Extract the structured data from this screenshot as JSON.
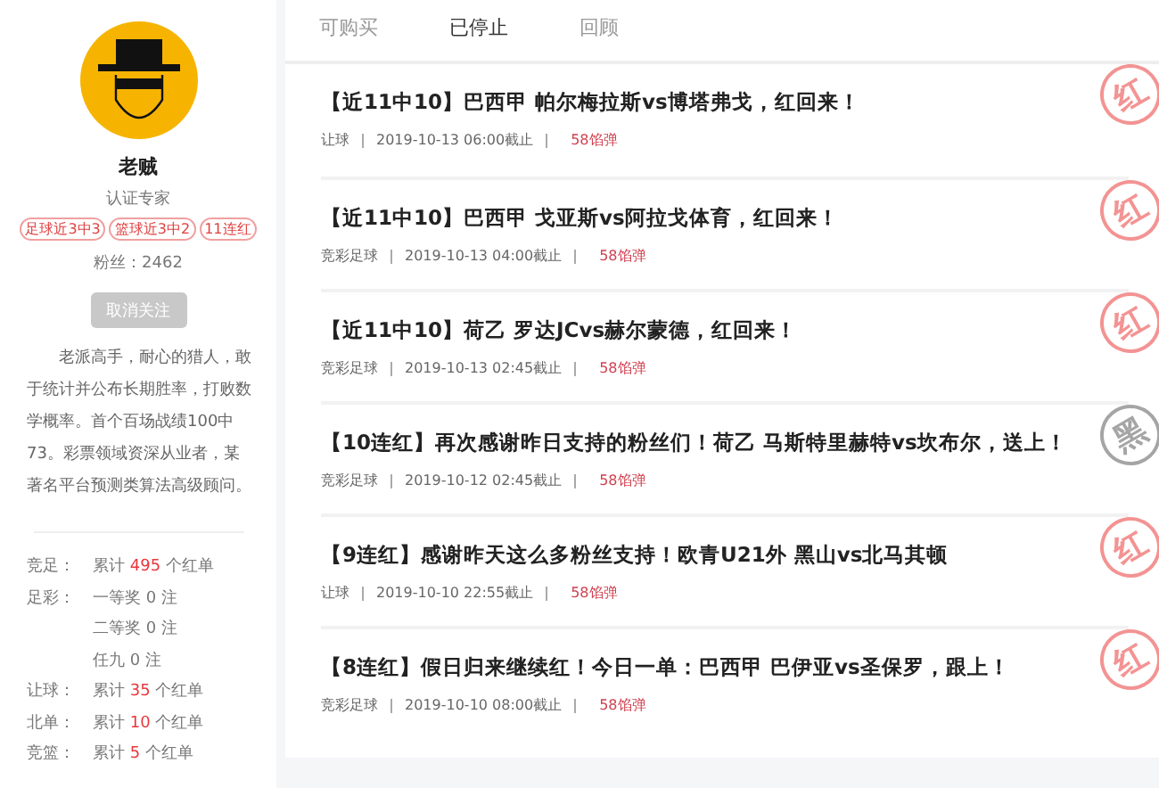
{
  "profile": {
    "name": "老贼",
    "role": "认证专家",
    "badges": [
      "足球近3中3",
      "篮球近3中2",
      "11连红"
    ],
    "fans_label": "粉丝：",
    "fans": "2462",
    "follow_button": "取消关注",
    "bio": "老派高手，耐心的猎人，敢于统计并公布长期胜率，打败数学概率。首个百场战绩100中73。彩票领域资深从业者，某著名平台预测类算法高级顾问。"
  },
  "stats": [
    {
      "label": "竞足：",
      "prefix": "累计",
      "count": "495",
      "suffix": "个红单",
      "highlight": true
    },
    {
      "label": "足彩：",
      "prefix": "一等奖",
      "count": "0",
      "suffix": "注",
      "highlight": false
    },
    {
      "prefix": "二等奖",
      "count": "0",
      "suffix": "注",
      "highlight": false
    },
    {
      "prefix": "任九",
      "count": "0",
      "suffix": "注",
      "highlight": false
    },
    {
      "label": "让球：",
      "prefix": "累计",
      "count": "35",
      "suffix": "个红单",
      "highlight": true
    },
    {
      "label": "北单：",
      "prefix": "累计",
      "count": "10",
      "suffix": "个红单",
      "highlight": true
    },
    {
      "label": "竞篮：",
      "prefix": "累计",
      "count": "5",
      "suffix": "个红单",
      "highlight": true
    }
  ],
  "tabs": [
    {
      "label": "可购买",
      "selected": false
    },
    {
      "label": "已停止",
      "selected": true
    },
    {
      "label": "回顾",
      "selected": false
    }
  ],
  "posts": [
    {
      "title": "【近11中10】巴西甲 帕尔梅拉斯vs博塔弗戈，红回来！",
      "category": "让球",
      "deadline": "2019-10-13 06:00截止",
      "price": "58馅弹",
      "stamp": {
        "text": "红",
        "kind": "hit"
      }
    },
    {
      "title": "【近11中10】巴西甲 戈亚斯vs阿拉戈体育，红回来！",
      "category": "竞彩足球",
      "deadline": "2019-10-13 04:00截止",
      "price": "58馅弹",
      "stamp": {
        "text": "红",
        "kind": "hit"
      }
    },
    {
      "title": "【近11中10】荷乙 罗达JCvs赫尔蒙德，红回来！",
      "category": "竞彩足球",
      "deadline": "2019-10-13 02:45截止",
      "price": "58馅弹",
      "stamp": {
        "text": "红",
        "kind": "hit"
      }
    },
    {
      "title": "【10连红】再次感谢昨日支持的粉丝们！荷乙 马斯特里赫特vs坎布尔，送上！",
      "category": "竞彩足球",
      "deadline": "2019-10-12 02:45截止",
      "price": "58馅弹",
      "stamp": {
        "text": "黑",
        "kind": "miss"
      }
    },
    {
      "title": "【9连红】感谢昨天这么多粉丝支持！欧青U21外 黑山vs北马其顿",
      "category": "让球",
      "deadline": "2019-10-10 22:55截止",
      "price": "58馅弹",
      "stamp": {
        "text": "红",
        "kind": "hit"
      }
    },
    {
      "title": "【8连红】假日归来继续红！今日一单：巴西甲 巴伊亚vs圣保罗，跟上！",
      "category": "竞彩足球",
      "deadline": "2019-10-10 08:00截止",
      "price": "58馅弹",
      "stamp": {
        "text": "红",
        "kind": "hit"
      }
    }
  ]
}
